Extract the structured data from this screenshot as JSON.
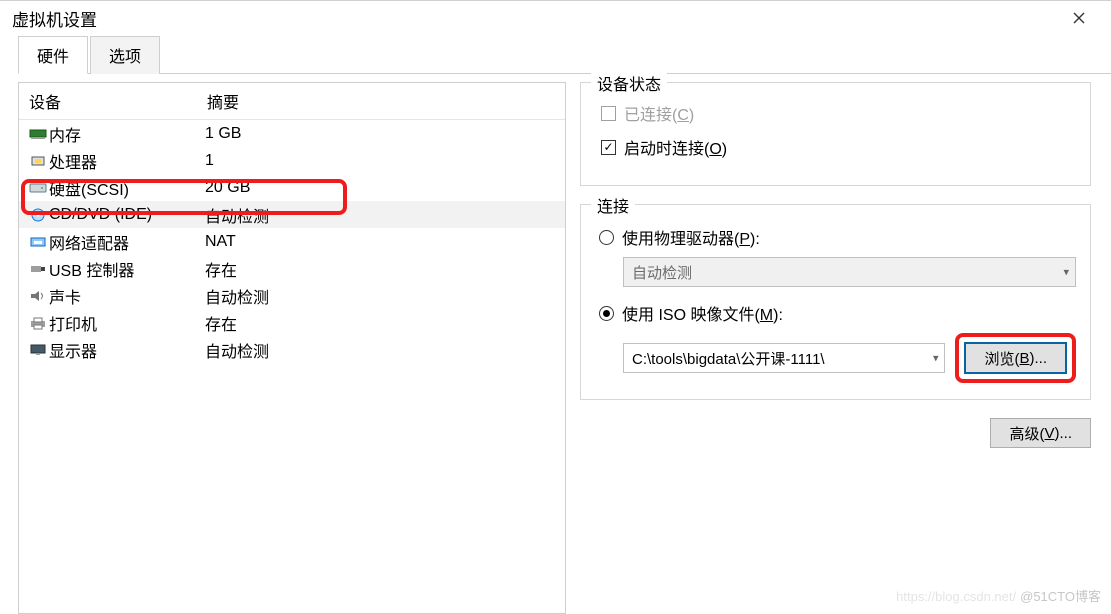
{
  "window": {
    "title": "虚拟机设置"
  },
  "tabs": {
    "hardware": "硬件",
    "options": "选项"
  },
  "device_header": {
    "device": "设备",
    "summary": "摘要"
  },
  "devices": [
    {
      "name": "内存",
      "summary": "1 GB",
      "icon": "memory-icon"
    },
    {
      "name": "处理器",
      "summary": "1",
      "icon": "cpu-icon"
    },
    {
      "name": "硬盘(SCSI)",
      "summary": "20 GB",
      "icon": "hdd-icon"
    },
    {
      "name": "CD/DVD (IDE)",
      "summary": "自动检测",
      "icon": "disc-icon",
      "selected": true
    },
    {
      "name": "网络适配器",
      "summary": "NAT",
      "icon": "nic-icon"
    },
    {
      "name": "USB 控制器",
      "summary": "存在",
      "icon": "usb-icon"
    },
    {
      "name": "声卡",
      "summary": "自动检测",
      "icon": "sound-icon"
    },
    {
      "name": "打印机",
      "summary": "存在",
      "icon": "printer-icon"
    },
    {
      "name": "显示器",
      "summary": "自动检测",
      "icon": "display-icon"
    }
  ],
  "device_state": {
    "legend": "设备状态",
    "connected_pre": "已连接(",
    "connected_u": "C",
    "connected_post": ")",
    "connect_at_poweron_pre": "启动时连接(",
    "connect_at_poweron_u": "O",
    "connect_at_poweron_post": ")"
  },
  "connection": {
    "legend": "连接",
    "physical_pre": "使用物理驱动器(",
    "physical_u": "P",
    "physical_post": "):",
    "autodetect": "自动检测",
    "iso_pre": "使用 ISO 映像文件(",
    "iso_u": "M",
    "iso_post": "):",
    "iso_path": "C:\\tools\\bigdata\\公开课-1111\\",
    "browse_pre": "浏览(",
    "browse_u": "B",
    "browse_post": ")..."
  },
  "advanced": {
    "pre": "高级(",
    "u": "V",
    "post": ")..."
  },
  "watermark": {
    "faint": "https://blog.csdn.net/",
    "bold": "@51CTO博客"
  }
}
